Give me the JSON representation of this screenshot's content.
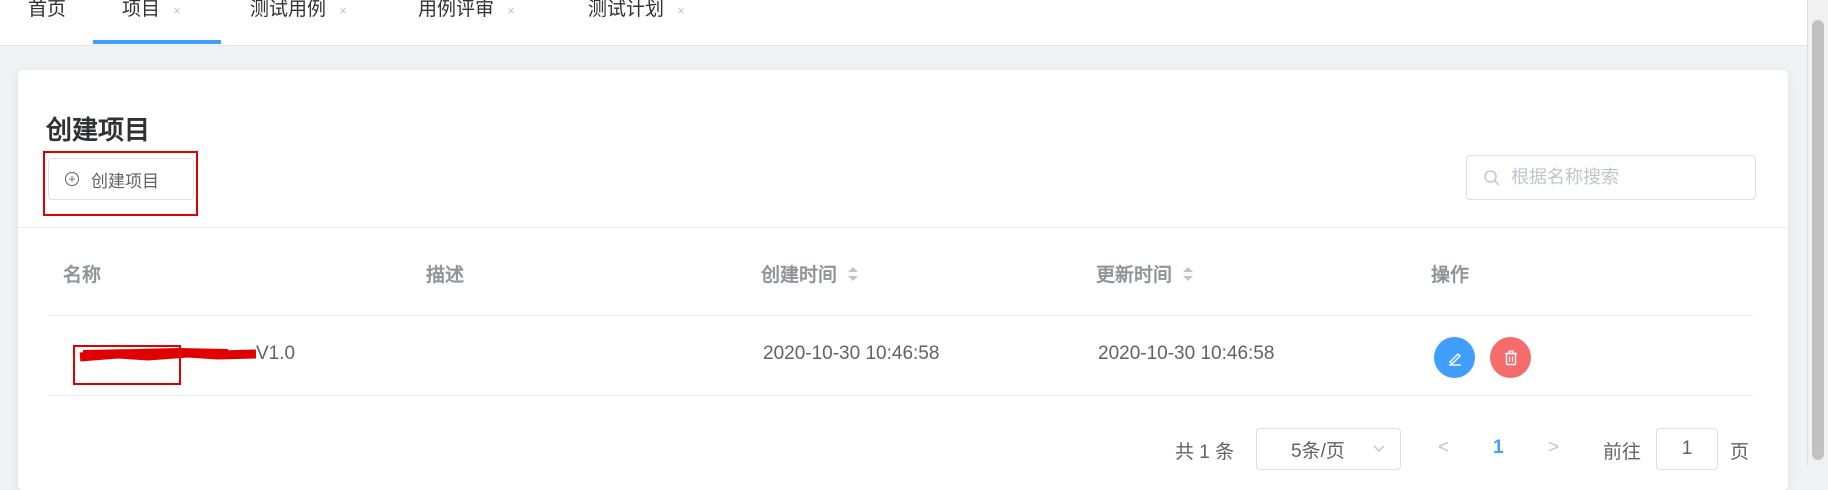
{
  "tabs": [
    {
      "label": "首页",
      "active": false
    },
    {
      "label": "项目",
      "active": true
    },
    {
      "label": "测试用例",
      "active": false
    },
    {
      "label": "用例评审",
      "active": false
    },
    {
      "label": "测试计划",
      "active": false
    }
  ],
  "tab_close_glyph": "×",
  "page": {
    "title": "创建项目",
    "create_button_label": "创建项目",
    "search_placeholder": "根据名称搜索"
  },
  "table": {
    "columns": [
      "名称",
      "描述",
      "创建时间",
      "更新时间",
      "操作"
    ],
    "rows": [
      {
        "name_visible_suffix": "V1.0",
        "description": "",
        "created": "2020-10-30 10:46:58",
        "updated": "2020-10-30 10:46:58"
      }
    ]
  },
  "pagination": {
    "total_text": "共 1 条",
    "page_size": "5条/页",
    "prev": "<",
    "current": "1",
    "next": ">",
    "goto_label": "前往",
    "goto_value": "1",
    "page_suffix": "页"
  },
  "colors": {
    "primary": "#409eff",
    "danger": "#f56c6c",
    "annotation_red": "#e00000"
  }
}
